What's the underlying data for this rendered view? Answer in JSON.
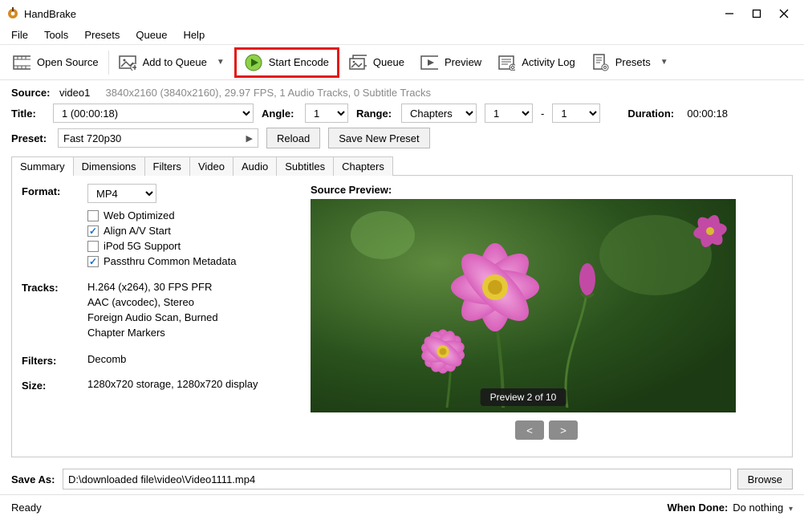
{
  "titlebar": {
    "app_name": "HandBrake"
  },
  "menu": {
    "file": "File",
    "tools": "Tools",
    "presets": "Presets",
    "queue": "Queue",
    "help": "Help"
  },
  "toolbar": {
    "open_source": "Open Source",
    "add_to_queue": "Add to Queue",
    "start_encode": "Start Encode",
    "queue": "Queue",
    "preview": "Preview",
    "activity_log": "Activity Log",
    "presets": "Presets"
  },
  "source": {
    "label": "Source:",
    "name": "video1",
    "detail": "3840x2160 (3840x2160), 29.97 FPS, 1 Audio Tracks, 0 Subtitle Tracks"
  },
  "title_row": {
    "title_label": "Title:",
    "title_value": "1  (00:00:18)",
    "angle_label": "Angle:",
    "angle_value": "1",
    "range_label": "Range:",
    "range_mode": "Chapters",
    "range_from": "1",
    "range_sep": "-",
    "range_to": "1",
    "duration_label": "Duration:",
    "duration_value": "00:00:18"
  },
  "preset_row": {
    "preset_label": "Preset:",
    "preset_value": "Fast 720p30",
    "reload": "Reload",
    "save_new": "Save New Preset"
  },
  "tabs": {
    "summary": "Summary",
    "dimensions": "Dimensions",
    "filters": "Filters",
    "video": "Video",
    "audio": "Audio",
    "subtitles": "Subtitles",
    "chapters": "Chapters"
  },
  "summary": {
    "format_label": "Format:",
    "format_value": "MP4",
    "web_optimized": "Web Optimized",
    "align_av": "Align A/V Start",
    "ipod": "iPod 5G Support",
    "passthru": "Passthru Common Metadata",
    "tracks_label": "Tracks:",
    "tracks_1": "H.264 (x264), 30 FPS PFR",
    "tracks_2": "AAC (avcodec), Stereo",
    "tracks_3": "Foreign Audio Scan, Burned",
    "tracks_4": "Chapter Markers",
    "filters_label": "Filters:",
    "filters_value": "Decomb",
    "size_label": "Size:",
    "size_value": "1280x720 storage, 1280x720 display",
    "preview_label": "Source Preview:",
    "preview_badge": "Preview 2 of 10",
    "nav_prev": "<",
    "nav_next": ">"
  },
  "saveas": {
    "label": "Save As:",
    "path": "D:\\downloaded file\\video\\Video1111.mp4",
    "browse": "Browse"
  },
  "status": {
    "ready": "Ready",
    "when_done_label": "When Done:",
    "when_done_value": "Do nothing"
  }
}
